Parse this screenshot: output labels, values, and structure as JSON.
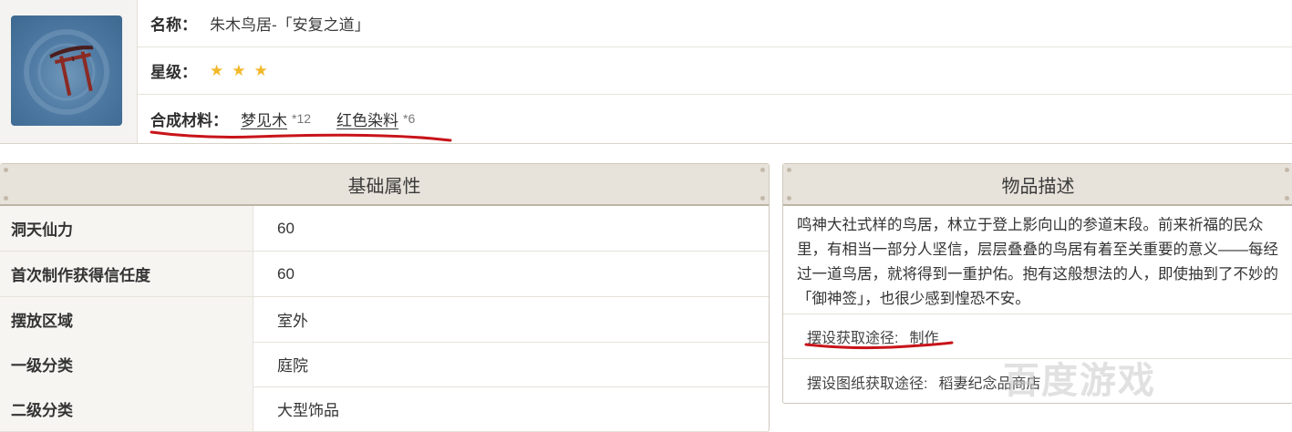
{
  "item": {
    "name_label": "名称：",
    "name_value": "朱木鸟居-「安复之道」",
    "rarity_label": "星级：",
    "stars": 3,
    "materials_label": "合成材料：",
    "materials": [
      {
        "name": "梦见木",
        "qty": "*12"
      },
      {
        "name": "红色染料",
        "qty": "*6"
      }
    ]
  },
  "attributes": {
    "title": "基础属性",
    "rows": [
      {
        "key": "洞天仙力",
        "value": "60"
      },
      {
        "key": "首次制作获得信任度",
        "value": "60"
      },
      {
        "key": "摆放区域",
        "value": "室外"
      },
      {
        "key": "一级分类",
        "value": "庭院"
      },
      {
        "key": "二级分类",
        "value": "大型饰品"
      }
    ]
  },
  "description": {
    "title": "物品描述",
    "text": "鸣神大社式样的鸟居，林立于登上影向山的参道末段。前来祈福的民众里，有相当一部分人坚信，层层叠叠的鸟居有着至关重要的意义——每经过一道鸟居，就将得到一重护佑。抱有这般想法的人，即使抽到了不妙的「御神签」，也很少感到惶恐不安。",
    "source_label": "摆设获取途径:",
    "source_value": "制作",
    "blueprint_label": "摆设图纸获取途径:",
    "blueprint_value": "稻妻纪念品商店"
  },
  "watermark": "百度游戏",
  "colors": {
    "star": "#f2b829",
    "annotation_red": "#c8141a",
    "header_bg": "#e7e2da"
  }
}
